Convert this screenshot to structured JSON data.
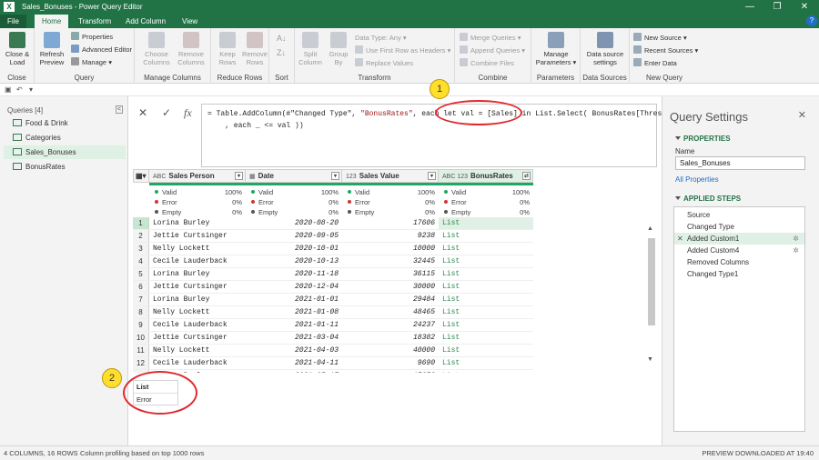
{
  "window": {
    "title": "Sales_Bonuses - Power Query Editor",
    "app_badge": "X"
  },
  "tabs": [
    {
      "label": "File"
    },
    {
      "label": "Home"
    },
    {
      "label": "Transform"
    },
    {
      "label": "Add Column"
    },
    {
      "label": "View"
    }
  ],
  "ribbon": {
    "close": {
      "btn": "Close & Load",
      "group": "Close"
    },
    "query": {
      "refresh": "Refresh Preview",
      "properties": "Properties",
      "advanced": "Advanced Editor",
      "manage": "Manage",
      "group": "Query"
    },
    "manage_columns": {
      "choose": "Choose Columns",
      "remove": "Remove Columns",
      "group": "Manage Columns"
    },
    "reduce_rows": {
      "keep": "Keep Rows",
      "remove": "Remove Rows",
      "group": "Reduce Rows"
    },
    "sort": {
      "group": "Sort"
    },
    "transform": {
      "split": "Split Column",
      "group_by": "Group By",
      "data_type": "Data Type: Any",
      "first_row": "Use First Row as Headers",
      "replace": "Replace Values",
      "group": "Transform"
    },
    "combine": {
      "merge": "Merge Queries",
      "append": "Append Queries",
      "files": "Combine Files",
      "group": "Combine"
    },
    "parameters": {
      "manage": "Manage Parameters",
      "group": "Parameters"
    },
    "data_sources": {
      "settings": "Data source settings",
      "group": "Data Sources"
    },
    "new_query": {
      "new_source": "New Source",
      "recent": "Recent Sources",
      "enter": "Enter Data",
      "group": "New Query"
    }
  },
  "queries_pane": {
    "header": "Queries [4]",
    "count": "<",
    "items": [
      "Food & Drink",
      "Categories",
      "Sales_Bonuses",
      "BonusRates"
    ]
  },
  "formula": {
    "line1_a": "= Table.AddColumn(#\"Changed Type\", ",
    "line1_s": "\"BonusRates\"",
    "line1_b": ", each let val = [Sales] in List.Select( BonusRates[Threshold]",
    "line2": "    , each _ <= val ))"
  },
  "grid": {
    "columns": [
      {
        "type": "ABC",
        "name": "Sales Person",
        "valid": "100%",
        "error": "0%",
        "empty": "0%"
      },
      {
        "type": "",
        "name": "Date",
        "valid": "100%",
        "error": "0%",
        "empty": "0%"
      },
      {
        "type": "123",
        "name": "Sales Value",
        "valid": "100%",
        "error": "0%",
        "empty": "0%"
      },
      {
        "type": "ABC 123",
        "name": "BonusRates",
        "valid": "100%",
        "error": "0%",
        "empty": "0%"
      }
    ],
    "profile_labels": {
      "valid": "Valid",
      "error": "Error",
      "empty": "Empty"
    },
    "rows": [
      {
        "n": "1",
        "person": "Lorina Burley",
        "date": "2020-08-20",
        "value": "17606",
        "bonus": "List"
      },
      {
        "n": "2",
        "person": "Jettie Curtsinger",
        "date": "2020-09-05",
        "value": "9238",
        "bonus": "List"
      },
      {
        "n": "3",
        "person": "Nelly Lockett",
        "date": "2020-10-01",
        "value": "10000",
        "bonus": "List"
      },
      {
        "n": "4",
        "person": "Cecile Lauderback",
        "date": "2020-10-13",
        "value": "32445",
        "bonus": "List"
      },
      {
        "n": "5",
        "person": "Lorina Burley",
        "date": "2020-11-18",
        "value": "36115",
        "bonus": "List"
      },
      {
        "n": "6",
        "person": "Jettie Curtsinger",
        "date": "2020-12-04",
        "value": "30000",
        "bonus": "List"
      },
      {
        "n": "7",
        "person": "Lorina Burley",
        "date": "2021-01-01",
        "value": "29484",
        "bonus": "List"
      },
      {
        "n": "8",
        "person": "Nelly Lockett",
        "date": "2021-01-08",
        "value": "48465",
        "bonus": "List"
      },
      {
        "n": "9",
        "person": "Cecile Lauderback",
        "date": "2021-01-11",
        "value": "24237",
        "bonus": "List"
      },
      {
        "n": "10",
        "person": "Jettie Curtsinger",
        "date": "2021-03-04",
        "value": "18382",
        "bonus": "List"
      },
      {
        "n": "11",
        "person": "Nelly Lockett",
        "date": "2021-04-03",
        "value": "40000",
        "bonus": "List"
      },
      {
        "n": "12",
        "person": "Cecile Lauderback",
        "date": "2021-04-11",
        "value": "9690",
        "bonus": "List"
      },
      {
        "n": "13",
        "person": "Lorina Burley",
        "date": "2021-05-17",
        "value": "17273",
        "bonus": "List"
      }
    ]
  },
  "preview": {
    "header": "List",
    "value": "Error"
  },
  "settings": {
    "title": "Query Settings",
    "properties_header": "PROPERTIES",
    "name_label": "Name",
    "name_value": "Sales_Bonuses",
    "all_props": "All Properties",
    "steps_header": "APPLIED STEPS",
    "steps": [
      "Source",
      "Changed Type",
      "Added Custom1",
      "Added Custom4",
      "Removed Columns",
      "Changed Type1"
    ]
  },
  "status": {
    "left": "4 COLUMNS, 16 ROWS",
    "profiling": "Column profiling based on top 1000 rows",
    "right": "PREVIEW DOWNLOADED AT 19:40"
  },
  "annotations": [
    "1",
    "2"
  ],
  "colors": {
    "accent": "#217346",
    "annotation": "#e0292e",
    "badge": "#ffdf2b"
  }
}
